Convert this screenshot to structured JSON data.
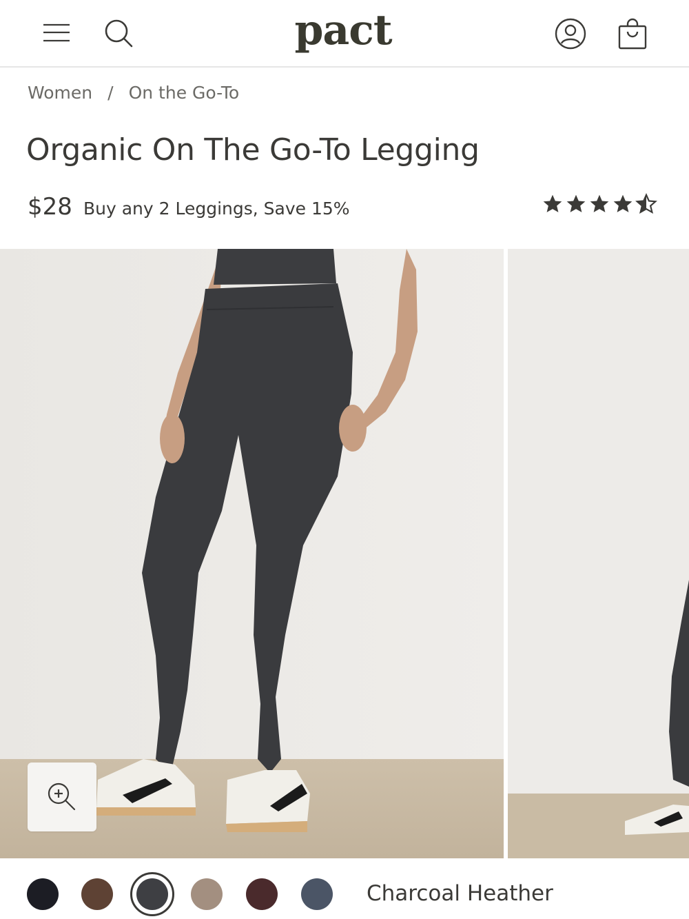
{
  "header": {
    "logo_text": "pact",
    "icons": {
      "menu": "hamburger-menu-icon",
      "search": "search-icon",
      "account": "account-icon",
      "bag": "shopping-bag-icon"
    }
  },
  "breadcrumb": {
    "items": [
      "Women",
      "On the Go-To"
    ],
    "separator": "/"
  },
  "product": {
    "title": "Organic On The Go-To Legging",
    "price": "$28",
    "promo": "Buy any 2 Leggings, Save 15%",
    "rating": 4.5,
    "rating_max": 5
  },
  "gallery": {
    "zoom_icon": "zoom-in-icon"
  },
  "colors": {
    "selected_name": "Charcoal Heather",
    "swatches": [
      {
        "hex": "#1c1d24"
      },
      {
        "hex": "#5e4234"
      },
      {
        "hex": "#3e3f43"
      },
      {
        "hex": "#a38f80"
      },
      {
        "hex": "#4a2a2c"
      },
      {
        "hex": "#4b5566"
      }
    ]
  }
}
